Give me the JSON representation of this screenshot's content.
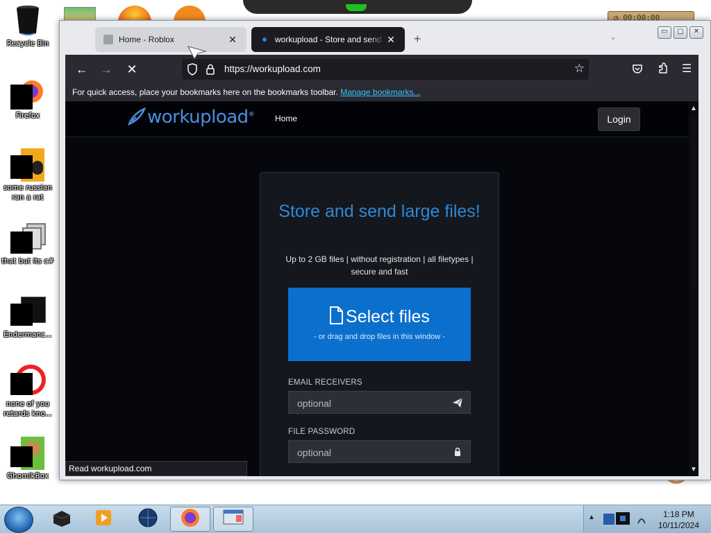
{
  "desktop": {
    "icons": [
      {
        "label": "Recycle Bin"
      },
      {
        "label": "Firefox"
      },
      {
        "label": "some russian ran a rat"
      },
      {
        "label": "that but its c#"
      },
      {
        "label": "Endermanc..."
      },
      {
        "label": "none of you retards kno..."
      },
      {
        "label": "GhomikBox"
      }
    ],
    "timer_text": "00:00:00"
  },
  "browser": {
    "tabs": [
      {
        "title": "Home - Roblox",
        "close": "✕"
      },
      {
        "title": "workupload - Store and send large files",
        "close": "✕"
      }
    ],
    "url": "https://workupload.com",
    "bookmarks_text": "For quick access, place your bookmarks here on the bookmarks toolbar.",
    "bookmarks_link": "Manage bookmarks...",
    "status_text": "Read workupload.com"
  },
  "site": {
    "logo_text": "workupload",
    "logo_mark": "®",
    "nav_home": "Home",
    "login": "Login",
    "headline": "Store and send large files!",
    "subline": "Up to 2 GB files | without registration | all filetypes | secure and fast",
    "select_files": "Select files",
    "drop_hint": "- or drag and drop files in this window -",
    "email_label": "EMAIL RECEIVERS",
    "email_placeholder": "optional",
    "password_label": "FILE PASSWORD",
    "password_placeholder": "optional"
  },
  "taskbar": {
    "time": "1:18 PM",
    "date": "10/11/2024"
  },
  "colors": {
    "accent": "#0b6fce",
    "headline": "#2f88d8",
    "link": "#39c2f7"
  }
}
